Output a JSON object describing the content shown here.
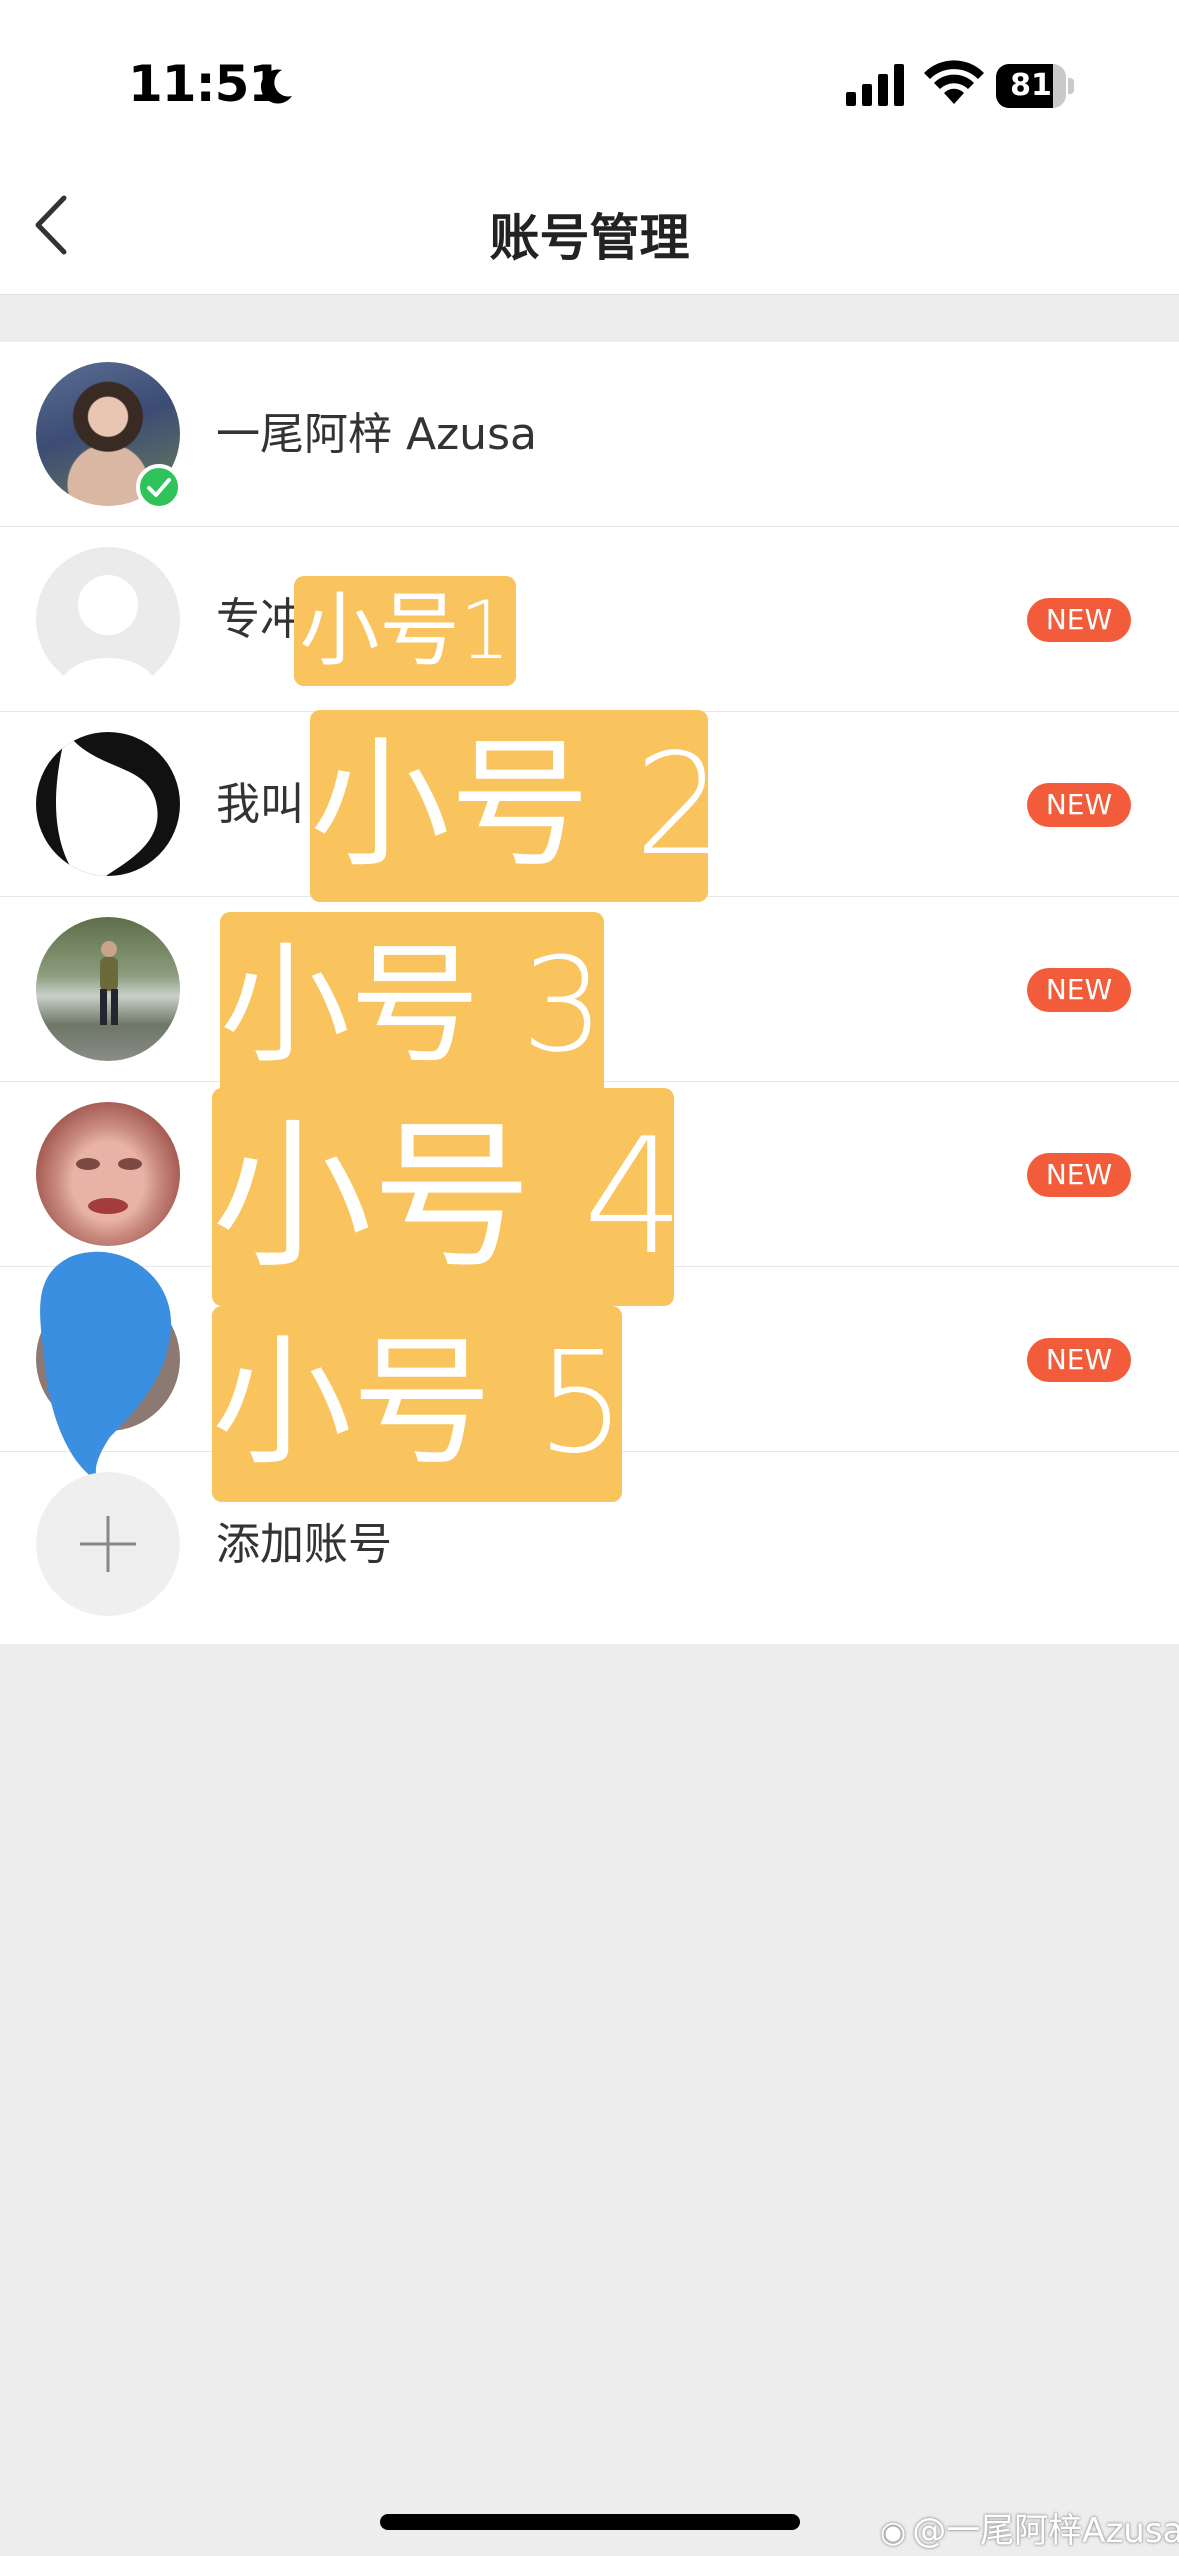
{
  "status_bar": {
    "time": "11:51",
    "battery": "81",
    "battery_level": 0.81
  },
  "nav": {
    "title": "账号管理"
  },
  "accounts": [
    {
      "name": "一尾阿梓 Azusa",
      "verified": true
    },
    {
      "name": "专冲",
      "badge": "NEW",
      "overlay": "小号1"
    },
    {
      "name": "我叫",
      "badge": "NEW",
      "overlay": "小号 2"
    },
    {
      "name": "",
      "badge": "NEW",
      "overlay": "小号 3"
    },
    {
      "name": "",
      "badge": "NEW",
      "overlay": "小号 4"
    },
    {
      "name": "",
      "badge": "NEW",
      "overlay": "小号 5"
    }
  ],
  "add_account": {
    "label": "添加账号"
  },
  "watermark": "@一尾阿梓Azusa",
  "colors": {
    "badge": "#f25c3b",
    "overlay": "#f9c35d",
    "verified": "#2fc35a",
    "scribble": "#3b8fe0"
  }
}
